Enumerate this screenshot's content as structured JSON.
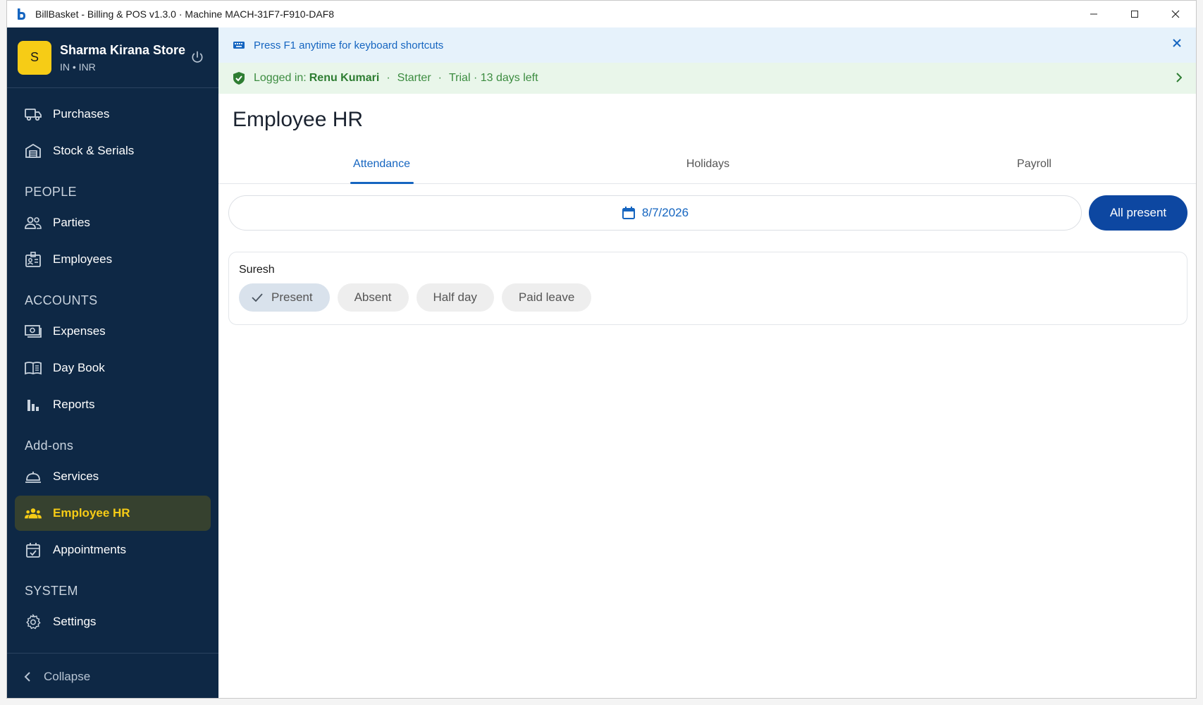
{
  "window": {
    "title": "BillBasket - Billing & POS  v1.3.0  ·  Machine MACH-31F7-F910-DAF8",
    "icon": "billbasket-b-logo"
  },
  "sidebar": {
    "store": {
      "avatar_letter": "S",
      "name": "Sharma Kirana Store",
      "sub": "IN • INR"
    },
    "items": [
      {
        "label": "Purchases",
        "icon": "truck-icon"
      },
      {
        "label": "Stock & Serials",
        "icon": "warehouse-icon"
      }
    ],
    "sections": {
      "people": "PEOPLE",
      "accounts": "ACCOUNTS",
      "addons": "Add-ons",
      "system": "SYSTEM"
    },
    "people_items": [
      {
        "label": "Parties",
        "icon": "people-icon"
      },
      {
        "label": "Employees",
        "icon": "badge-icon"
      }
    ],
    "accounts_items": [
      {
        "label": "Expenses",
        "icon": "cash-icon"
      },
      {
        "label": "Day Book",
        "icon": "book-icon"
      },
      {
        "label": "Reports",
        "icon": "bar-chart-icon"
      }
    ],
    "addons_items": [
      {
        "label": "Services",
        "icon": "room-service-icon"
      },
      {
        "label": "Employee HR",
        "icon": "groups-icon"
      },
      {
        "label": "Appointments",
        "icon": "calendar-check-icon"
      }
    ],
    "system_items": [
      {
        "label": "Settings",
        "icon": "gear-icon"
      }
    ],
    "collapse_label": "Collapse",
    "active_color": "#f6cc16",
    "bg_color": "#0e2845"
  },
  "banners": {
    "shortcut": "Press F1 anytime for keyboard shortcuts",
    "login_prefix": "Logged in:",
    "login_user": "Renu Kumari",
    "plan": "Starter",
    "trial": "Trial · 13 days left"
  },
  "page": {
    "title": "Employee HR",
    "tabs": [
      "Attendance",
      "Holidays",
      "Payroll"
    ],
    "active_tab": "Attendance"
  },
  "attendance": {
    "date": "8/7/2026",
    "all_present_label": "All present",
    "employees": [
      {
        "name": "Suresh",
        "options": [
          "Present",
          "Absent",
          "Half day",
          "Paid leave"
        ],
        "selected": "Present"
      }
    ]
  },
  "colors": {
    "primary": "#0d47a1",
    "link": "#1565c0",
    "success": "#2e7d32"
  }
}
